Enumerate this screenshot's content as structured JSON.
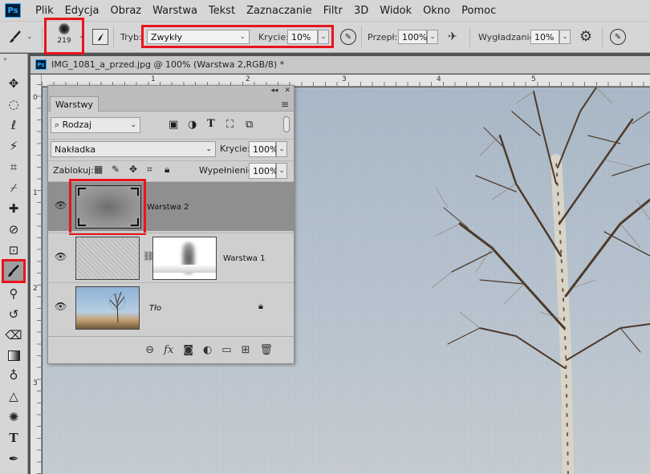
{
  "menubar": {
    "logo": "Ps",
    "items": [
      "Plik",
      "Edycja",
      "Obraz",
      "Warstwa",
      "Tekst",
      "Zaznaczanie",
      "Filtr",
      "3D",
      "Widok",
      "Okno",
      "Pomoc"
    ]
  },
  "options": {
    "brush_size": "219",
    "mode_label": "Tryb:",
    "mode_value": "Zwykły",
    "opacity_label": "Krycie:",
    "opacity_value": "10%",
    "flow_label": "Przepł:",
    "flow_value": "100%",
    "smoothing_label": "Wygładzanie:",
    "smoothing_value": "10%"
  },
  "document": {
    "tab_title": "IMG_1081_a_przed.jpg @ 100% (Warstwa 2,RGB/8) *",
    "ruler_top": [
      "1",
      "2",
      "3",
      "4",
      "5"
    ],
    "ruler_left": [
      "0",
      "1",
      "2",
      "3"
    ]
  },
  "layers_panel": {
    "tab": "Warstwy",
    "filter_kind": "Rodzaj",
    "blend_mode": "Nakładka",
    "opacity_label": "Krycie:",
    "opacity_value": "100%",
    "lock_label": "Zablokuj:",
    "fill_label": "Wypełnienie:",
    "fill_value": "100%",
    "layers": [
      {
        "name": "Warstwa 2",
        "selected": true
      },
      {
        "name": "Warstwa 1",
        "selected": false
      },
      {
        "name": "Tło",
        "selected": false
      }
    ],
    "bottom_icons": [
      "link-icon",
      "fx-icon",
      "mask-icon",
      "adjustment-icon",
      "group-icon",
      "new-layer-icon",
      "trash-icon"
    ]
  },
  "colors": {
    "highlight": "#e8141c",
    "panel": "#cfcfcf",
    "selected_layer": "#8f8f8f"
  }
}
